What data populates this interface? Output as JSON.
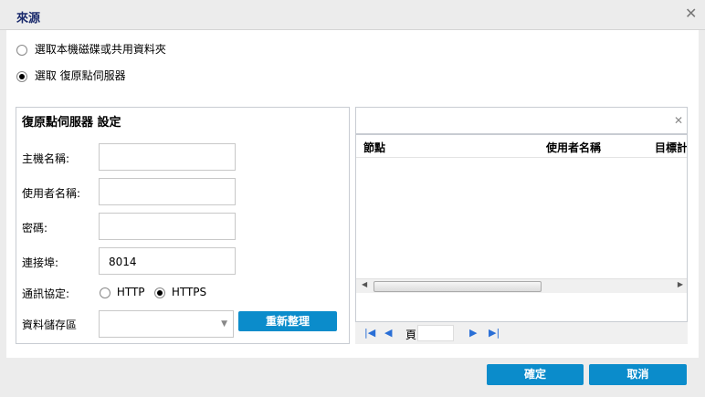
{
  "dialog": {
    "title": "來源"
  },
  "source_options": [
    {
      "label": "選取本機磁碟或共用資料夾",
      "selected": false
    },
    {
      "label": "選取 復原點伺服器",
      "selected": true
    }
  ],
  "settings": {
    "title": "復原點伺服器 設定",
    "hostname_label": "主機名稱:",
    "hostname_value": "",
    "username_label": "使用者名稱:",
    "username_value": "",
    "password_label": "密碼:",
    "password_value": "",
    "port_label": "連接埠:",
    "port_value": "8014",
    "protocol_label": "通訊協定:",
    "protocol_options": [
      {
        "label": "HTTP",
        "selected": false
      },
      {
        "label": "HTTPS",
        "selected": true
      }
    ],
    "datastore_label": "資料儲存區",
    "datastore_value": "",
    "refresh_label": "重新整理"
  },
  "grid": {
    "columns": [
      "節點",
      "使用者名稱",
      "目標計"
    ],
    "rows": [],
    "page_label": "頁",
    "page_value": ""
  },
  "footer": {
    "ok_label": "確定",
    "cancel_label": "取消"
  }
}
